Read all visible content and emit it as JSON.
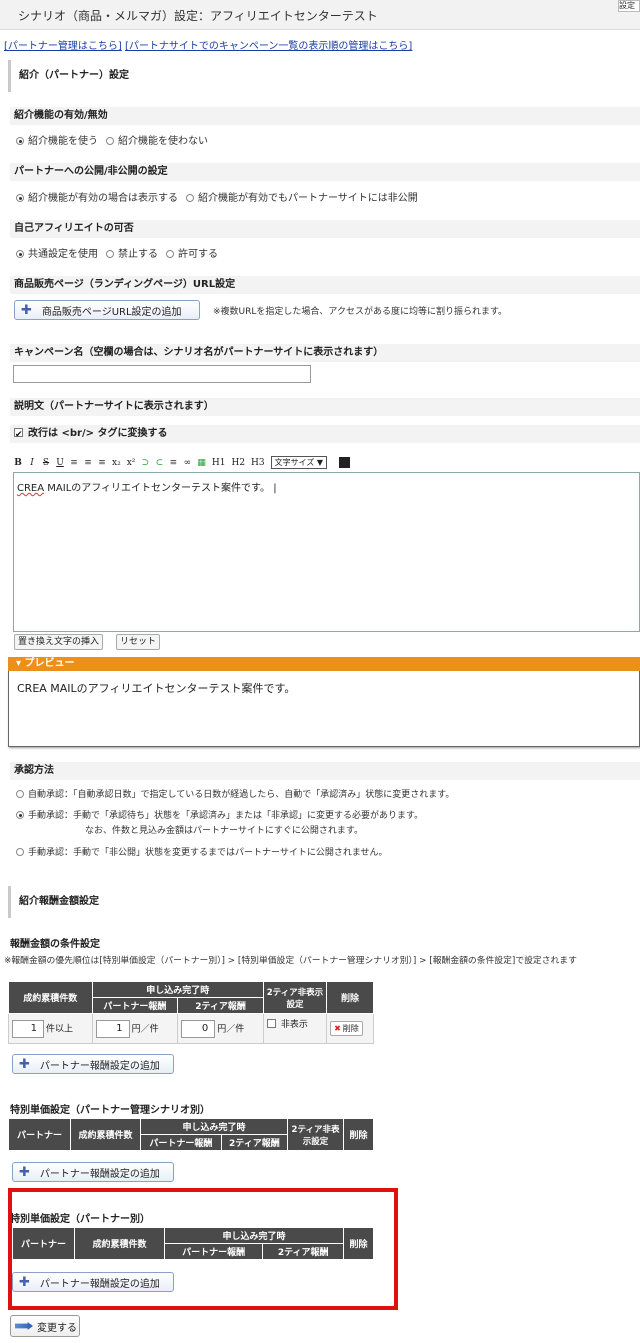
{
  "header": {
    "title": "シナリオ（商品・メルマガ）設定：アフィリエイトセンターテスト",
    "corner_button": "設定"
  },
  "links": {
    "partner_manage": "[パートナー管理はこちら]",
    "campaign_order": "[パートナサイトでのキャンペーン一覧の表示順の管理はこちら]"
  },
  "section_referral": {
    "title": "紹介（パートナー）設定"
  },
  "referral_enable": {
    "label": "紹介機能の有効/無効",
    "options": [
      "紹介機能を使う",
      "紹介機能を使わない"
    ]
  },
  "partner_public": {
    "label": "パートナーへの公開/非公開の設定",
    "options": [
      "紹介機能が有効の場合は表示する",
      "紹介機能が有効でもパートナーサイトには非公開"
    ]
  },
  "self_affiliate": {
    "label": "自己アフィリエイトの可否",
    "options": [
      "共通設定を使用",
      "禁止する",
      "許可する"
    ]
  },
  "landing": {
    "label": "商品販売ページ（ランディングページ）URL設定",
    "add_button": "商品販売ページURL設定の追加",
    "note": "※複数URLを指定した場合、アクセスがある度に均等に割り振られます。"
  },
  "campaign": {
    "label": "キャンペーン名（空欄の場合は、シナリオ名がパートナーサイトに表示されます）",
    "value": ""
  },
  "description": {
    "label": "説明文（パートナーサイトに表示されます）",
    "convert_br": "改行は <br/> タグに変換する",
    "toolbar": [
      "B",
      "I",
      "S",
      "U",
      "≡",
      "≡",
      "≡",
      "x₂",
      "x²",
      "⊃",
      "⊂",
      "≡",
      "∞",
      "▦",
      "H1",
      "H2",
      "H3"
    ],
    "font_size_select": "文字サイズ ▼",
    "content_prefix": "CREA",
    "content_rest": " MAILのアフィリエイトセンターテスト案件です。",
    "insert_button": "置き換え文字の挿入",
    "reset_button": "リセット"
  },
  "preview": {
    "title": "▾ プレビュー",
    "content": "CREA MAILのアフィリエイトセンターテスト案件です。"
  },
  "approval": {
    "label": "承認方法",
    "opt1": "自動承認：「自動承認日数」で指定している日数が経過したら、自動で「承認済み」状態に変更されます。",
    "opt2a": "手動承認：手動で「承認待ち」状態を「承認済み」または「非承認」に変更する必要があります。",
    "opt2b": "なお、件数と見込み金額はパートナーサイトにすぐに公開されます。",
    "opt3": "手動承認：手動で「非公開」状態を変更するまではパートナーサイトに公開されません。"
  },
  "section_reward": {
    "title": "紹介報酬金額設定"
  },
  "reward_conditions": {
    "label": "報酬金額の条件設定",
    "note": "※報酬金額の優先順位は[特別単価設定（パートナー別）] > [特別単価設定（パートナー管理シナリオ別）] > [報酬金額の条件設定]で設定されます",
    "headers": {
      "count": "成約累積件数",
      "app_complete": "申し込み完了時",
      "partner_reward": "パートナー報酬",
      "tier2_reward": "2ティア報酬",
      "tier2_hide": "2ティア非表示設定",
      "delete": "削除"
    },
    "row": {
      "count": "1",
      "count_unit": "件以上",
      "partner": "1",
      "partner_unit": "円／件",
      "tier2": "0",
      "tier2_unit": "円／件",
      "hide": "非表示",
      "delete": "削除"
    },
    "add_button": "パートナー報酬設定の追加"
  },
  "special_scenario": {
    "label": "特別単価設定（パートナー管理シナリオ別）",
    "headers": {
      "partner": "パートナー",
      "count": "成約累積件数",
      "app_complete": "申し込み完了時",
      "partner_reward": "パートナー報酬",
      "tier2_reward": "2ティア報酬",
      "tier2_hide": "2ティア非表示設定",
      "delete": "削除"
    },
    "add_button": "パートナー報酬設定の追加"
  },
  "special_partner": {
    "label": "特別単価設定（パートナー別）",
    "headers": {
      "partner": "パートナー",
      "count": "成約累積件数",
      "app_complete": "申し込み完了時",
      "partner_reward": "パートナー報酬",
      "tier2_reward": "2ティア報酬",
      "delete": "削除"
    },
    "add_button": "パートナー報酬設定の追加"
  },
  "submit": {
    "label": "変更する"
  }
}
